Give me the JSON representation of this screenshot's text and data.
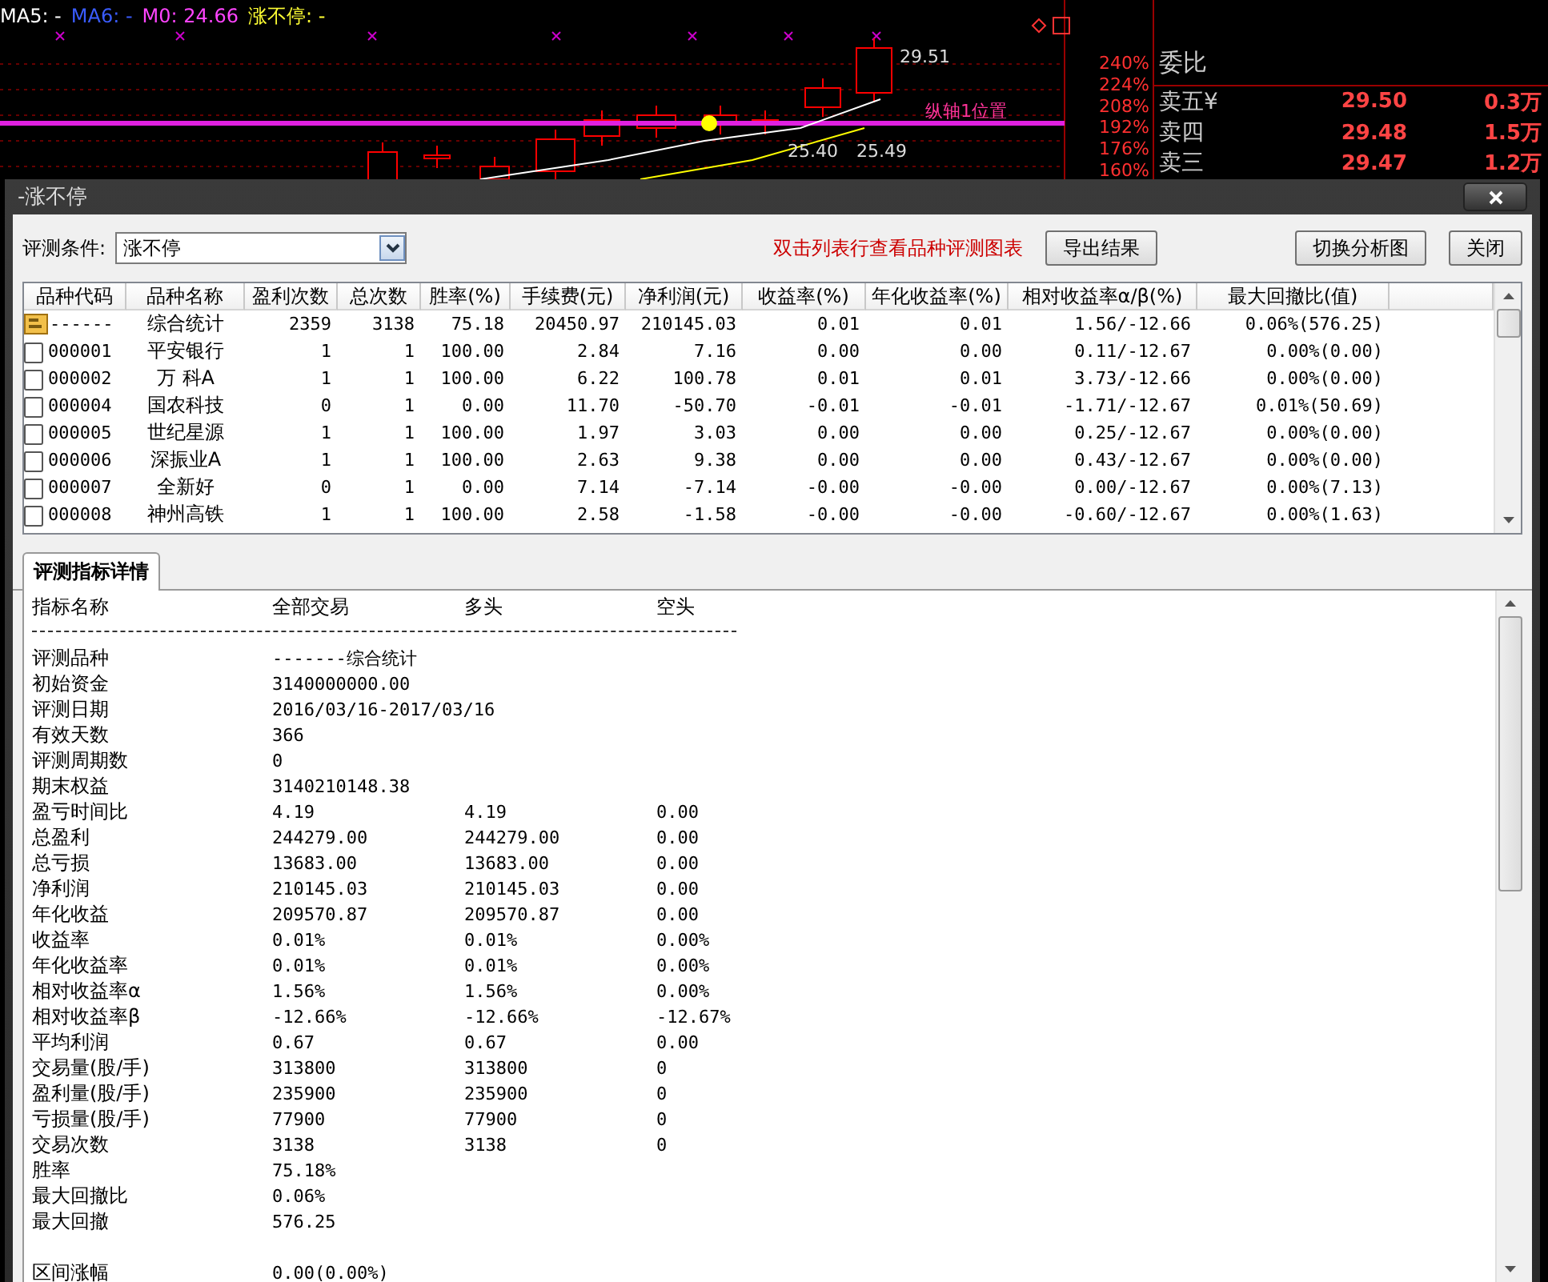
{
  "chart": {
    "legend": [
      {
        "text": "MA5: -",
        "color": "#ffffff"
      },
      {
        "text": "MA6: -",
        "color": "#3a5cff"
      },
      {
        "text": "M0: 24.66",
        "color": "#ff44ff"
      },
      {
        "text": "涨不停: -",
        "color": "#ffff33"
      }
    ],
    "price_labels": [
      "29.51",
      "25.40",
      "25.49"
    ],
    "axis_note": "纵轴1位置",
    "axis_labels": [
      "240%",
      "224%",
      "208%",
      "192%",
      "176%",
      "160%"
    ]
  },
  "order_book": {
    "title": "委比",
    "rows": [
      {
        "label": "卖五¥",
        "price": "29.50",
        "volume": "0.3万"
      },
      {
        "label": "卖四",
        "price": "29.48",
        "volume": "1.5万"
      },
      {
        "label": "卖三",
        "price": "29.47",
        "volume": "1.2万"
      }
    ]
  },
  "dialog": {
    "title": "-涨不停",
    "condition_label": "评测条件:",
    "condition_value": "涨不停",
    "hint": "双击列表行查看品种评测图表",
    "buttons": [
      "导出结果",
      "切换分析图",
      "关闭"
    ]
  },
  "table": {
    "columns": [
      "品种代码",
      "品种名称",
      "盈利次数",
      "总次数",
      "胜率(%)",
      "手续费(元)",
      "净利润(元)",
      "收益率(%)",
      "年化收益率(%)",
      "相对收益率α/β(%)",
      "最大回撤比(值)"
    ],
    "rows": [
      {
        "kind": "summary",
        "cells": [
          "------",
          "综合统计",
          "2359",
          "3138",
          "75.18",
          "20450.97",
          "210145.03",
          "0.01",
          "0.01",
          "1.56/-12.66",
          "0.06%(576.25)"
        ]
      },
      {
        "kind": "stock",
        "cells": [
          "000001",
          "平安银行",
          "1",
          "1",
          "100.00",
          "2.84",
          "7.16",
          "0.00",
          "0.00",
          "0.11/-12.67",
          "0.00%(0.00)"
        ]
      },
      {
        "kind": "stock",
        "cells": [
          "000002",
          "万 科A",
          "1",
          "1",
          "100.00",
          "6.22",
          "100.78",
          "0.01",
          "0.01",
          "3.73/-12.66",
          "0.00%(0.00)"
        ]
      },
      {
        "kind": "stock",
        "cells": [
          "000004",
          "国农科技",
          "0",
          "1",
          "0.00",
          "11.70",
          "-50.70",
          "-0.01",
          "-0.01",
          "-1.71/-12.67",
          "0.01%(50.69)"
        ]
      },
      {
        "kind": "stock",
        "cells": [
          "000005",
          "世纪星源",
          "1",
          "1",
          "100.00",
          "1.97",
          "3.03",
          "0.00",
          "0.00",
          "0.25/-12.67",
          "0.00%(0.00)"
        ]
      },
      {
        "kind": "stock",
        "cells": [
          "000006",
          "深振业A",
          "1",
          "1",
          "100.00",
          "2.63",
          "9.38",
          "0.00",
          "0.00",
          "0.43/-12.67",
          "0.00%(0.00)"
        ]
      },
      {
        "kind": "stock",
        "cells": [
          "000007",
          "全新好",
          "0",
          "1",
          "0.00",
          "7.14",
          "-7.14",
          "-0.00",
          "-0.00",
          "0.00/-12.67",
          "0.00%(7.13)"
        ]
      },
      {
        "kind": "stock",
        "cells": [
          "000008",
          "神州高铁",
          "1",
          "1",
          "100.00",
          "2.58",
          "-1.58",
          "-0.00",
          "-0.00",
          "-0.60/-12.67",
          "0.00%(1.63)"
        ]
      }
    ]
  },
  "tabs": [
    {
      "label": "评测指标详情",
      "selected": true
    }
  ],
  "details": {
    "columns": [
      "指标名称",
      "全部交易",
      "多头",
      "空头"
    ],
    "rows": [
      {
        "cells": [
          "评测品种",
          "-------综合统计"
        ]
      },
      {
        "cells": [
          "初始资金",
          "3140000000.00"
        ]
      },
      {
        "cells": [
          "评测日期",
          "2016/03/16-2017/03/16"
        ]
      },
      {
        "cells": [
          "有效天数",
          "366"
        ]
      },
      {
        "cells": [
          "评测周期数",
          "0"
        ]
      },
      {
        "cells": [
          "期末权益",
          "3140210148.38"
        ]
      },
      {
        "cells": [
          "盈亏时间比",
          "4.19",
          "4.19",
          "0.00"
        ]
      },
      {
        "cells": [
          "总盈利",
          "244279.00",
          "244279.00",
          "0.00"
        ]
      },
      {
        "cells": [
          "总亏损",
          "13683.00",
          "13683.00",
          "0.00"
        ]
      },
      {
        "cells": [
          "净利润",
          "210145.03",
          "210145.03",
          "0.00"
        ]
      },
      {
        "cells": [
          "年化收益",
          "209570.87",
          "209570.87",
          "0.00"
        ]
      },
      {
        "cells": [
          "收益率",
          "0.01%",
          "0.01%",
          "0.00%"
        ]
      },
      {
        "cells": [
          "年化收益率",
          "0.01%",
          "0.01%",
          "0.00%"
        ]
      },
      {
        "cells": [
          "相对收益率α",
          "1.56%",
          "1.56%",
          "0.00%"
        ]
      },
      {
        "cells": [
          "相对收益率β",
          "-12.66%",
          "-12.66%",
          "-12.67%"
        ]
      },
      {
        "cells": [
          "平均利润",
          "0.67",
          "0.67",
          "0.00"
        ]
      },
      {
        "cells": [
          "交易量(股/手)",
          "313800",
          "313800",
          "0"
        ]
      },
      {
        "cells": [
          "盈利量(股/手)",
          "235900",
          "235900",
          "0"
        ]
      },
      {
        "cells": [
          "亏损量(股/手)",
          "77900",
          "77900",
          "0"
        ]
      },
      {
        "cells": [
          "交易次数",
          "3138",
          "3138",
          "0"
        ]
      },
      {
        "cells": [
          "胜率",
          "75.18%"
        ]
      },
      {
        "cells": [
          "最大回撤比",
          "0.06%"
        ]
      },
      {
        "cells": [
          "最大回撤",
          "576.25"
        ]
      },
      {
        "cells": []
      },
      {
        "cells": [
          "区间涨幅",
          "0.00(0.00%)"
        ]
      }
    ]
  }
}
